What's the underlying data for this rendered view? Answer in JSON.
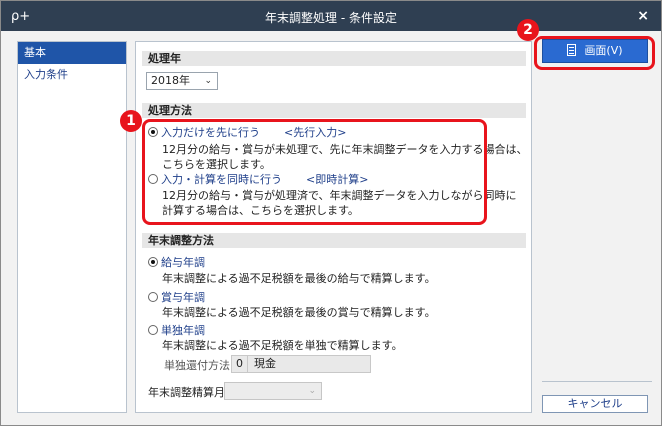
{
  "window": {
    "title": "年末調整処理 - 条件設定",
    "search_glyph": "ρ+",
    "close_glyph": "×"
  },
  "sidebar": {
    "items": [
      {
        "label": "基本",
        "active": true
      },
      {
        "label": "入力条件",
        "active": false
      }
    ]
  },
  "main": {
    "year_section": {
      "title": "処理年",
      "selected": "2018年"
    },
    "method_section": {
      "title": "処理方法",
      "options": [
        {
          "label": "入力だけを先に行う",
          "tag": "<先行入力>",
          "checked": true,
          "desc": [
            "12月分の給与・賞与が未処理で、先に年末調整データを入力する場合は、",
            "こちらを選択します。"
          ]
        },
        {
          "label": "入力・計算を同時に行う",
          "tag": "<即時計算>",
          "checked": false,
          "desc": [
            "12月分の給与・賞与が処理済で、年末調整データを入力しながら同時に",
            "計算する場合は、こちらを選択します。"
          ]
        }
      ]
    },
    "adjust_section": {
      "title": "年末調整方法",
      "options": [
        {
          "label": "給与年調",
          "checked": true,
          "desc": "年末調整による過不足税額を最後の給与で精算します。"
        },
        {
          "label": "賞与年調",
          "checked": false,
          "desc": "年末調整による過不足税額を最後の賞与で精算します。"
        },
        {
          "label": "単独年調",
          "checked": false,
          "desc": "年末調整による過不足税額を単独で精算します。"
        }
      ],
      "refund_method": {
        "label": "単独還付方法",
        "code": "0",
        "name": "現金"
      },
      "settle_month": {
        "label": "年末調整精算月",
        "value": ""
      }
    }
  },
  "right": {
    "screen_button": "画面(V)",
    "cancel_button": "キャンセル"
  },
  "callouts": {
    "badge_1": "1",
    "badge_2": "2",
    "color": "#e8141c"
  },
  "colors": {
    "titlebar": "#2f3f52",
    "accent_blue": "#2a6ad1",
    "link_text": "#1f3f8a"
  }
}
